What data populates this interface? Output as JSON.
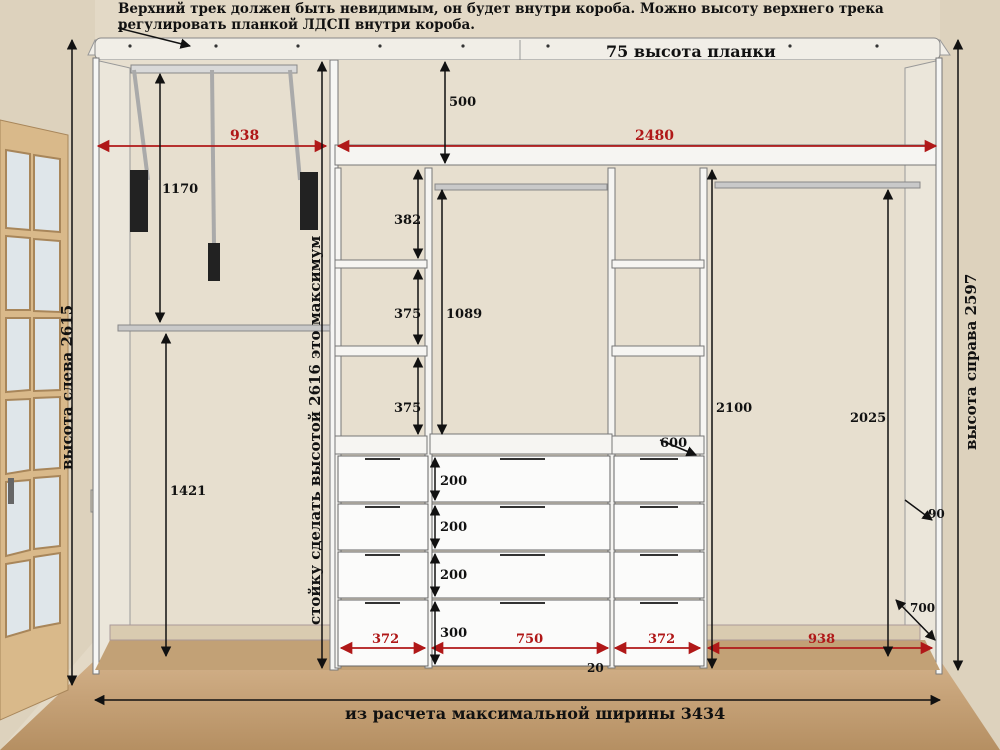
{
  "top_note": {
    "line1": "Верхний трек должен быть невидимым, он будет внутри короба. Можно высоту верхнего трека",
    "line2": "регулировать планкой ЛДСП внутри короба."
  },
  "labels": {
    "plank_height": "75 высота планки",
    "width_left": "938",
    "width_right": "2480",
    "top_gap": "500",
    "h_1170": "1170",
    "shelf_382": "382",
    "shelf_375a": "375",
    "shelf_375b": "375",
    "h_1089": "1089",
    "h_2100": "2100",
    "h_2025": "2025",
    "h_1421": "1421",
    "depth_600": "600",
    "drawer_200a": "200",
    "drawer_200b": "200",
    "drawer_200c": "200",
    "drawer_300": "300",
    "w_372a": "372",
    "w_750": "750",
    "w_372b": "372",
    "w_938b": "938",
    "gap_20": "20",
    "side_90": "90",
    "depth_700": "700",
    "left_height": "высота слева 2615",
    "right_height": "высота справа 2597",
    "post_note": "стойку сделать высотой 2616 это максимум",
    "max_width": "из расчета максимальной ширины 3434"
  },
  "colors": {
    "wall": "#e6ddcc",
    "floor": "#c9a77c",
    "carcass": "#f4f4f2",
    "dim_red": "#b01818",
    "dim_black": "#111111",
    "door": "#d9b98a"
  }
}
